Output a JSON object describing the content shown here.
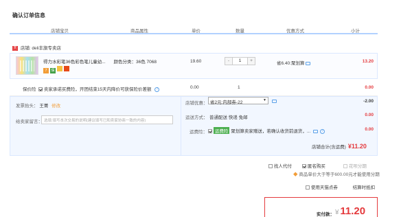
{
  "page_title": "确认订单信息",
  "columns": [
    "店铺宝贝",
    "商品属性",
    "单价",
    "数量",
    "优惠方式",
    "小计"
  ],
  "shop": {
    "icon_text": "天猫",
    "name": "店铺: deli丰旗专卖店"
  },
  "item": {
    "name": "得力水彩笔36色彩色笔儿童幼...",
    "attributes": "颜色分类：36色 7068",
    "price": "19.60",
    "quantity": "1",
    "minus": "-",
    "plus": "+",
    "promo": "省6.40:聚划算",
    "subtotal": "13.20",
    "badges": [
      "7",
      "保",
      "",
      ""
    ]
  },
  "insurance": {
    "label": "保价险",
    "text": "卖家承诺买费险，开团结束15天内降价可获保险价差额",
    "price": "0.00",
    "quantity": "1",
    "subtotal": "0.00"
  },
  "invoice": {
    "label": "发票抬头：",
    "value": "王菁",
    "edit": "修改"
  },
  "message": {
    "label": "给卖家留言：",
    "placeholder": "选填:填写本次交易的说明(建议填写已和卖家协商一致的内容)"
  },
  "shop_discount": {
    "label": "店铺优惠：",
    "selected": "省2元:内部券-22",
    "value": "-2.00"
  },
  "shipping": {
    "label": "运送方式：",
    "value": "普通配送 快递 免邮",
    "amount": "0.00"
  },
  "freight_insurance": {
    "label": "运费险：",
    "badge": "运费险",
    "text": "聚划算卖家赠送，若确认收货前退货，...",
    "amount": "0.00"
  },
  "store_total": {
    "label": "店铺合计(含运费)",
    "amount": "¥11.20"
  },
  "options": {
    "anon_pay": "找人代付",
    "anonymous": "匿名购买",
    "huabei": "花呗分期",
    "huabei_note": "商品单价大于等于600.00元才能使用分期"
  },
  "tmall_points": {
    "label": "使用天猫点券",
    "settle": "结算时抵扣"
  },
  "pay": {
    "label": "实付款：",
    "currency": "¥",
    "amount": "11.20"
  },
  "colors": {
    "accent": "#e4393c",
    "border_blue": "#b2d1ff",
    "panel_bg": "#f2f7ff"
  }
}
